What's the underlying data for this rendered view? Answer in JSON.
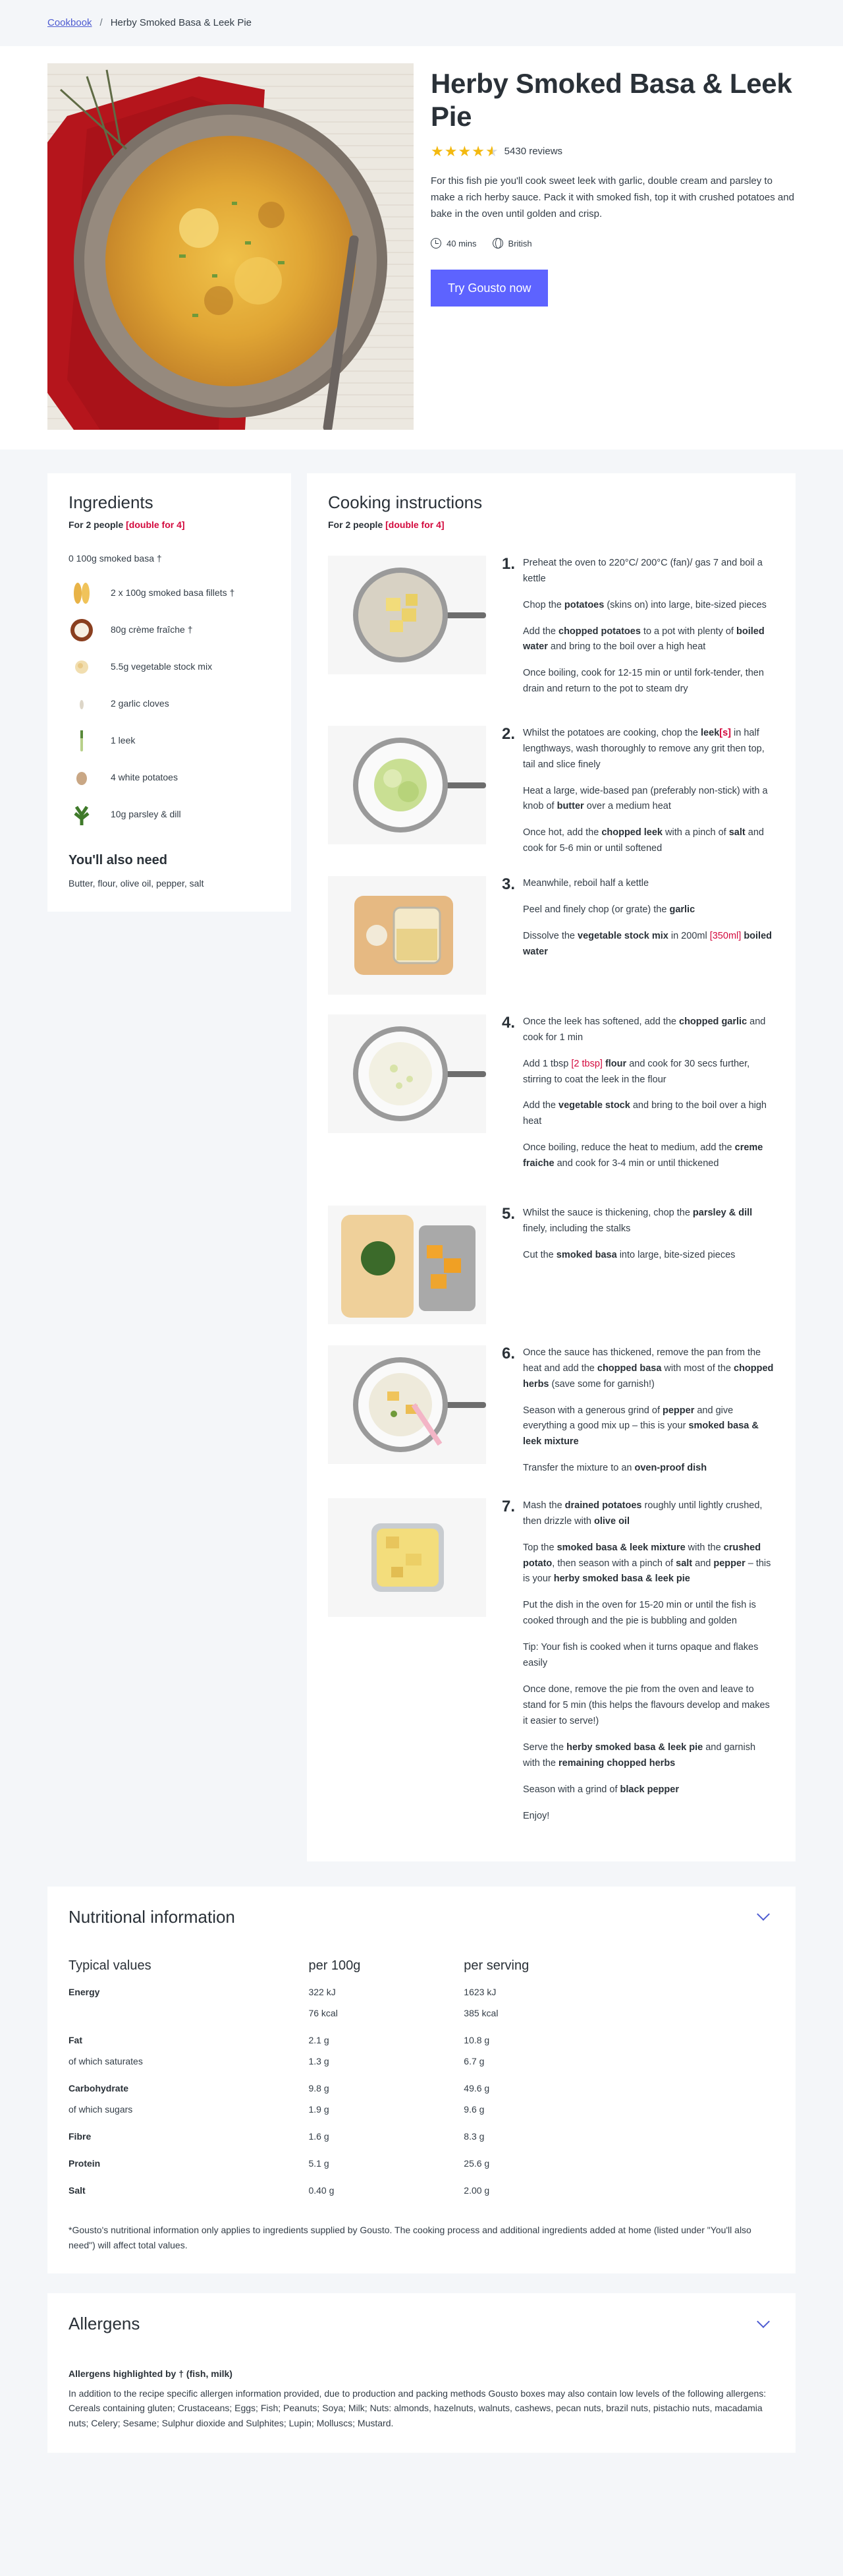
{
  "breadcrumb": {
    "root": "Cookbook",
    "separator": "/",
    "current": "Herby Smoked Basa & Leek Pie"
  },
  "hero": {
    "title": "Herby Smoked Basa & Leek Pie",
    "rating": 4.5,
    "reviews": "5430 reviews",
    "description": "For this fish pie you'll cook sweet leek with garlic, double cream and parsley to make a rich herby sauce. Pack it with smoked fish, top it with crushed potatoes and bake in the oven until golden and crisp.",
    "time": "40 mins",
    "cuisine": "British",
    "cta": "Try Gousto now"
  },
  "ingredients": {
    "title": "Ingredients",
    "serves": "For 2 people",
    "double": "[double for 4]",
    "first": "0 100g smoked basa †",
    "items": [
      {
        "label": "2 x 100g smoked basa fillets †",
        "icon": "fish-fillet-icon"
      },
      {
        "label": "80g crème fraîche †",
        "icon": "creme-fraiche-icon"
      },
      {
        "label": "5.5g vegetable stock mix",
        "icon": "stock-mix-icon"
      },
      {
        "label": "2 garlic cloves",
        "icon": "garlic-icon"
      },
      {
        "label": "1 leek",
        "icon": "leek-icon"
      },
      {
        "label": "4 white potatoes",
        "icon": "potato-icon"
      },
      {
        "label": "10g parsley & dill",
        "icon": "herbs-icon"
      }
    ],
    "also_title": "You'll also need",
    "also_text": "Butter, flour, olive oil, pepper, salt"
  },
  "instructions": {
    "title": "Cooking instructions",
    "serves": "For 2 people",
    "double": "[double for 4]",
    "steps": [
      {
        "num": "1.",
        "image": "boiling-potatoes-pan",
        "paras": [
          "Preheat the oven to 220°C/ 200°C (fan)/ gas 7 and boil a kettle",
          "Chop the **potatoes** (skins on) into large, bite-sized pieces",
          "Add the **chopped potatoes** to a pot with plenty of **boiled water** and bring to the boil over a high heat",
          "Once boiling, cook for 12-15 min or until fork-tender, then drain and return to the pot to steam dry"
        ]
      },
      {
        "num": "2.",
        "image": "leek-pan",
        "paras": [
          "Whilst the potatoes are cooking, chop the **leek[[(s)]]** in half lengthways, wash thoroughly to remove any grit then top, tail and slice finely",
          "Heat a large, wide-based pan (preferably non-stick) with a knob of **butter** over a medium heat",
          "Once hot, add the **chopped leek** with a pinch of **salt** and cook for 5-6 min or until softened"
        ]
      },
      {
        "num": "3.",
        "image": "stock-jug-board",
        "paras": [
          "Meanwhile, reboil half a kettle",
          "Peel and finely chop (or grate) the **garlic**",
          "Dissolve the **vegetable stock mix** in 200ml [[(350ml)]] **boiled water**"
        ]
      },
      {
        "num": "4.",
        "image": "creamy-sauce-pan",
        "paras": [
          "Once the leek has softened, add the **chopped garlic** and cook for 1 min",
          "Add 1 tbsp [[(2 tbsp)]] **flour** and cook for 30 secs further, stirring to coat the leek in the flour",
          "Add the **vegetable stock** and bring to the boil over a high heat",
          "Once boiling, reduce the heat to medium, add the **creme fraiche** and cook for 3-4 min or until thickened"
        ]
      },
      {
        "num": "5.",
        "image": "herbs-and-basa-boards",
        "paras": [
          "Whilst the sauce is thickening, chop the **parsley & dill** finely, including the stalks",
          "Cut the **smoked basa** into large, bite-sized pieces"
        ]
      },
      {
        "num": "6.",
        "image": "basa-in-sauce-pan",
        "paras": [
          "Once the sauce has thickened, remove the pan from the heat and add the **chopped basa** with most of the **chopped herbs** (save some for garnish!)",
          "Season with a generous grind of **pepper** and give everything a good mix up – this is your **smoked basa & leek mixture**",
          "Transfer the mixture to an **oven-proof dish**"
        ]
      },
      {
        "num": "7.",
        "image": "pie-dish",
        "paras": [
          "Mash the **drained potatoes** roughly until lightly crushed, then drizzle with **olive oil**",
          "Top the **smoked basa & leek mixture** with the **crushed potato**, then season with a pinch of **salt** and **pepper** – this is your **herby smoked basa & leek pie**",
          "Put the dish in the oven for 15-20 min or until the fish is cooked through and the pie is bubbling and golden",
          "Tip: Your fish is cooked when it turns opaque and flakes easily",
          "Once done, remove the pie from the oven and leave to stand for 5 min (this helps the flavours develop and makes it easier to serve!)",
          "Serve the **herby smoked basa & leek pie** and garnish with the **remaining chopped herbs**",
          "Season with a grind of **black pepper**",
          "Enjoy!"
        ]
      }
    ]
  },
  "nutrition": {
    "title": "Nutritional information",
    "headers": [
      "Typical values",
      "per 100g",
      "per serving"
    ],
    "rows": [
      {
        "label": "Energy",
        "per100": "322 kJ",
        "serving": "1623 kJ",
        "sub": false,
        "gap": false
      },
      {
        "label": "",
        "per100": "76 kcal",
        "serving": "385 kcal",
        "sub": true,
        "gap": false
      },
      {
        "label": "Fat",
        "per100": "2.1 g",
        "serving": "10.8 g",
        "sub": false,
        "gap": true
      },
      {
        "label": "of which saturates",
        "per100": "1.3 g",
        "serving": "6.7 g",
        "sub": true,
        "gap": false
      },
      {
        "label": "Carbohydrate",
        "per100": "9.8 g",
        "serving": "49.6 g",
        "sub": false,
        "gap": true
      },
      {
        "label": "of which sugars",
        "per100": "1.9 g",
        "serving": "9.6 g",
        "sub": true,
        "gap": false
      },
      {
        "label": "Fibre",
        "per100": "1.6 g",
        "serving": "8.3 g",
        "sub": false,
        "gap": true
      },
      {
        "label": "Protein",
        "per100": "5.1 g",
        "serving": "25.6 g",
        "sub": false,
        "gap": true
      },
      {
        "label": "Salt",
        "per100": "0.40 g",
        "serving": "2.00 g",
        "sub": false,
        "gap": true
      }
    ],
    "note": "*Gousto's nutritional information only applies to ingredients supplied by Gousto. The cooking process and additional ingredients added at home (listed under \"You'll also need\") will affect total values."
  },
  "allergens": {
    "title": "Allergens",
    "highlight": "Allergens highlighted by † (fish, milk)",
    "text": "In addition to the recipe specific allergen information provided, due to production and packing methods Gousto boxes may also contain low levels of the following allergens: Cereals containing gluten; Crustaceans; Eggs; Fish; Peanuts; Soya; Milk; Nuts: almonds, hazelnuts, walnuts, cashews, pecan nuts, brazil nuts, pistachio nuts, macadamia nuts; Celery; Sesame; Sulphur dioxide and Sulphites; Lupin; Molluscs; Mustard."
  },
  "colors": {
    "accent": "#5d63ff",
    "link": "#4d5bd1",
    "highlight": "#d3093d",
    "star": "#f3b910"
  }
}
